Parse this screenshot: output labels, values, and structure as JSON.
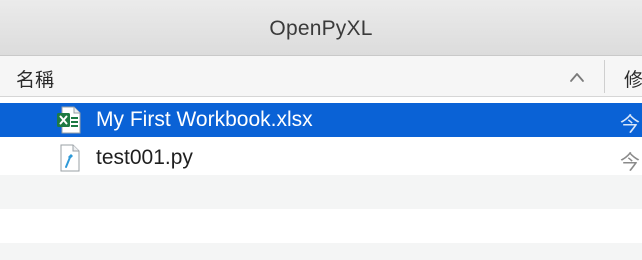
{
  "window": {
    "title": "OpenPyXL"
  },
  "columns": {
    "name_label": "名稱",
    "date_label": "修",
    "sort_icon": "chevron-up-icon"
  },
  "files": [
    {
      "name": "My First Workbook.xlsx",
      "icon": "excel-file-icon",
      "date": "今",
      "selected": true
    },
    {
      "name": "test001.py",
      "icon": "python-file-icon",
      "date": "今",
      "selected": false
    }
  ],
  "colors": {
    "selection": "#0a62d6",
    "excel_green": "#1d7a43",
    "python_blue": "#2f9ad8"
  }
}
